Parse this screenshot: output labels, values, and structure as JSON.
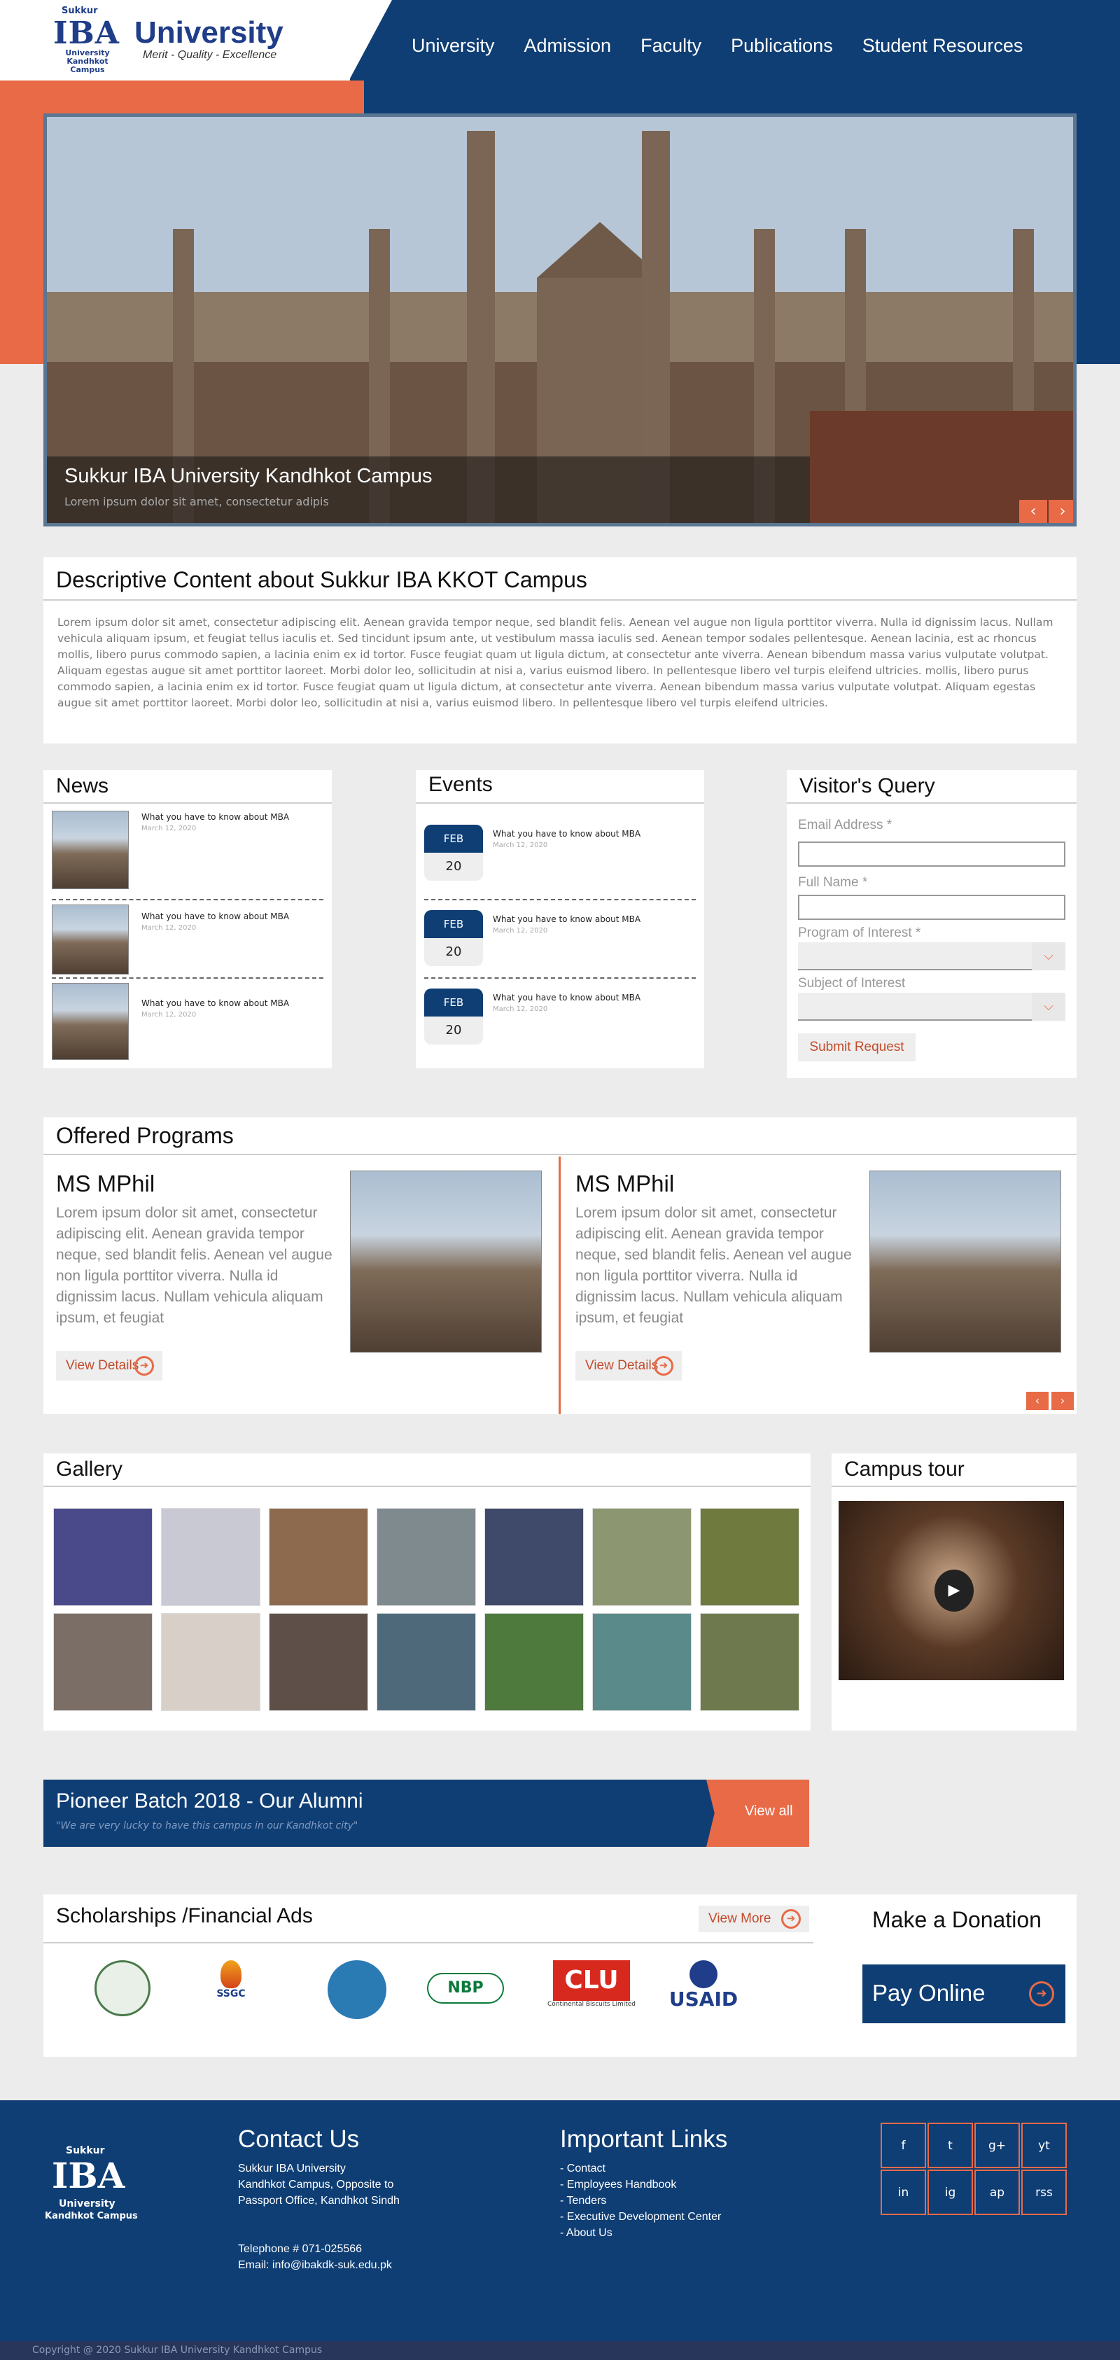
{
  "header": {
    "logo_small": "Sukkur",
    "logo_iba": "IBA",
    "logo_university": "University",
    "logo_campus": "University Kandhkot Campus",
    "tagline": "Merit - Quality - Excellence",
    "nav": [
      "University",
      "Admission",
      "Faculty",
      "Publications",
      "Student Resources"
    ]
  },
  "hero": {
    "title": "Sukkur IBA University Kandhkot Campus",
    "subtitle": "Lorem ipsum dolor sit amet, consectetur adipis",
    "prev": "‹",
    "next": "›"
  },
  "about": {
    "heading": "Descriptive Content about Sukkur IBA KKOT Campus",
    "body": "Lorem ipsum dolor sit amet, consectetur adipiscing elit. Aenean gravida tempor neque, sed blandit felis. Aenean vel augue non ligula porttitor viverra. Nulla id dignissim lacus. Nullam vehicula aliquam ipsum, et feugiat tellus iaculis et. Sed tincidunt ipsum ante, ut vestibulum massa iaculis sed. Aenean tempor sodales pellentesque. Aenean lacinia, est ac rhoncus mollis, libero purus commodo sapien, a lacinia enim ex id tortor. Fusce feugiat quam ut ligula dictum, at consectetur ante viverra. Aenean bibendum massa varius vulputate volutpat. Aliquam egestas augue sit amet porttitor laoreet. Morbi dolor leo, sollicitudin at nisi a, varius euismod libero. In pellentesque libero vel turpis eleifend ultricies. mollis, libero purus commodo sapien, a lacinia enim ex id tortor. Fusce feugiat quam ut ligula dictum, at consectetur ante viverra. Aenean bibendum massa varius vulputate volutpat. Aliquam egestas augue sit amet porttitor laoreet. Morbi dolor leo, sollicitudin at nisi a, varius euismod libero. In pellentesque libero vel turpis eleifend ultricies."
  },
  "news": {
    "heading": "News",
    "items": [
      {
        "title": "What you have to know about MBA",
        "date": "March 12, 2020"
      },
      {
        "title": "What you have to know about MBA",
        "date": "March 12, 2020"
      },
      {
        "title": "What you have to know about MBA",
        "date": "March 12, 2020"
      }
    ]
  },
  "events": {
    "heading": "Events",
    "items": [
      {
        "month": "FEB",
        "day": "20",
        "title": "What you have to know about MBA",
        "date": "March 12, 2020"
      },
      {
        "month": "FEB",
        "day": "20",
        "title": "What you have to know about MBA",
        "date": "March 12, 2020"
      },
      {
        "month": "FEB",
        "day": "20",
        "title": "What you have to know about MBA",
        "date": "March 12, 2020"
      }
    ]
  },
  "query": {
    "heading": "Visitor's Query",
    "email_label": "Email Address *",
    "name_label": "Full Name *",
    "program_label": "Program of Interest *",
    "subject_label": "Subject of Interest",
    "submit": "Submit Request"
  },
  "programs": {
    "heading": "Offered Programs",
    "items": [
      {
        "title": "MS MPhil",
        "text": "Lorem ipsum dolor sit amet, consectetur adipiscing elit. Aenean gravida tempor neque, sed blandit felis. Aenean vel augue non ligula porttitor viverra. Nulla id dignissim lacus. Nullam vehicula aliquam ipsum, et feugiat",
        "button": "View Details"
      },
      {
        "title": "MS MPhil",
        "text": "Lorem ipsum dolor sit amet, consectetur adipiscing elit. Aenean gravida tempor neque, sed blandit felis. Aenean vel augue non ligula porttitor viverra. Nulla id dignissim lacus. Nullam vehicula aliquam ipsum, et feugiat",
        "button": "View Details"
      }
    ]
  },
  "gallery": {
    "heading": "Gallery"
  },
  "tour": {
    "heading": "Campus tour"
  },
  "alumni": {
    "title": "Pioneer Batch 2018 - Our Alumni",
    "quote": "\"We are very lucky to have this campus in our Kandhkot city\"",
    "button": "View all"
  },
  "scholarships": {
    "heading": "Scholarships /Financial Ads",
    "more": "View More",
    "sponsors": [
      "",
      "SSGC",
      "",
      "NBP",
      "Continental Biscuits Limited",
      "USAID"
    ]
  },
  "donation": {
    "heading": "Make a Donation",
    "button": "Pay Online"
  },
  "footer": {
    "logo_small": "Sukkur",
    "logo_iba": "IBA",
    "logo_uni": "University",
    "logo_campus": "Kandhkot Campus",
    "contact_heading": "Contact Us",
    "contact_lines": [
      "Sukkur IBA University",
      "Kandhkot Campus, Opposite to",
      "Passport  Office, Kandhkot Sindh",
      "",
      "",
      "Telephone # 071-025566",
      "Email: info@ibakdk-suk.edu.pk"
    ],
    "links_heading": "Important Links",
    "links": [
      "- Contact",
      "- Employees Handbook",
      "- Tenders",
      "- Executive Development Center",
      "- About Us"
    ],
    "social": [
      "f",
      "t",
      "g+",
      "yt",
      "in",
      "ig",
      "ap",
      "rss"
    ],
    "copyright": "Copyright @ 2020 Sukkur IBA University Kandhkot Campus"
  },
  "colors": {
    "navy": "#0f3e74",
    "orange": "#e86a47",
    "bg": "#ececec"
  }
}
